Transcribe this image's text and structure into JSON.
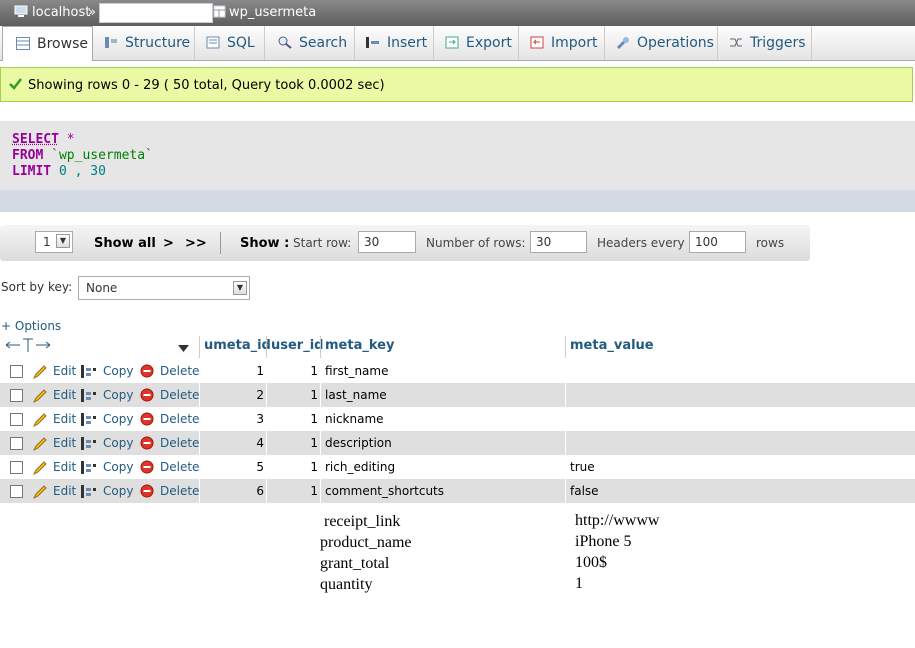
{
  "breadcrumb": {
    "server": "localhost",
    "separator": "»",
    "table": "wp_usermeta"
  },
  "tabs": [
    "Browse",
    "Structure",
    "SQL",
    "Search",
    "Insert",
    "Export",
    "Import",
    "Operations",
    "Triggers"
  ],
  "message": "Showing rows 0 - 29 ( 50 total, Query took 0.0002 sec)",
  "sql": {
    "select": "SELECT",
    "star": "*",
    "from": "FROM",
    "table": "`wp_usermeta`",
    "limit": "LIMIT",
    "limit_a": "0",
    "limit_comma": ",",
    "limit_b": "30"
  },
  "nav": {
    "page": "1",
    "show_all": "Show all",
    "next": ">",
    "last": ">>",
    "show_label": "Show :",
    "start_row_label": "Start row:",
    "start_row": "30",
    "num_rows_label": "Number of rows:",
    "num_rows": "30",
    "headers_label": "Headers every",
    "headers_every": "100",
    "rows_label": "rows"
  },
  "sort": {
    "label": "Sort by key:",
    "value": "None"
  },
  "options_link": "+ Options",
  "columns": [
    "umeta_id",
    "user_id",
    "meta_key",
    "meta_value"
  ],
  "actions": {
    "edit": "Edit",
    "copy": "Copy",
    "delete": "Delete"
  },
  "rows": [
    {
      "umeta_id": "1",
      "user_id": "1",
      "meta_key": "first_name",
      "meta_value": ""
    },
    {
      "umeta_id": "2",
      "user_id": "1",
      "meta_key": "last_name",
      "meta_value": ""
    },
    {
      "umeta_id": "3",
      "user_id": "1",
      "meta_key": "nickname",
      "meta_value": ""
    },
    {
      "umeta_id": "4",
      "user_id": "1",
      "meta_key": "description",
      "meta_value": ""
    },
    {
      "umeta_id": "5",
      "user_id": "1",
      "meta_key": "rich_editing",
      "meta_value": "true"
    },
    {
      "umeta_id": "6",
      "user_id": "1",
      "meta_key": "comment_shortcuts",
      "meta_value": "false"
    }
  ],
  "extra_rows": [
    {
      "key": "receipt_link",
      "value": "http://wwww"
    },
    {
      "key": "product_name",
      "value": "iPhone 5"
    },
    {
      "key": "grant_total",
      "value": "100$"
    },
    {
      "key": "quantity",
      "value": "1"
    }
  ],
  "colors": {
    "link": "#235a81",
    "keyword": "#990099",
    "success_bg": "#ebf8a4",
    "row_alt": "#dfdfdf"
  }
}
